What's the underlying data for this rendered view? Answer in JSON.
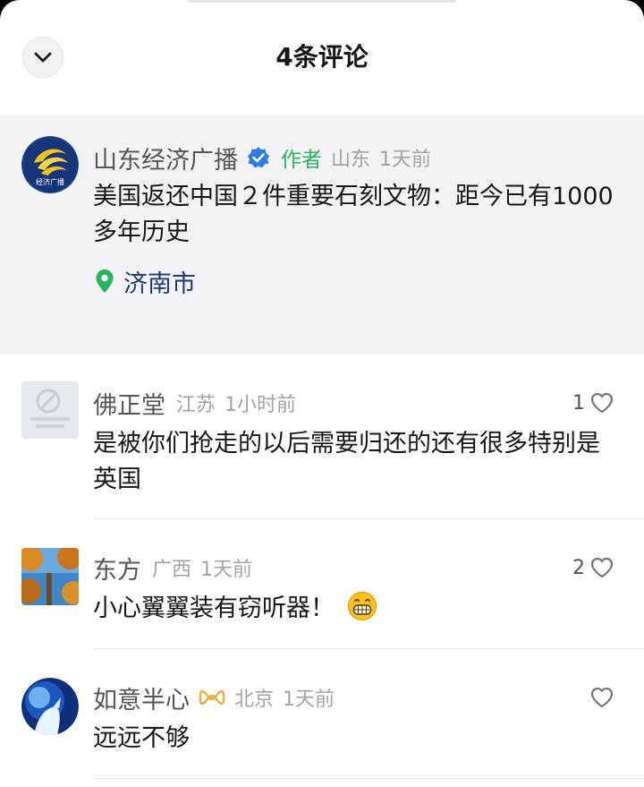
{
  "header": {
    "title": "4条评论"
  },
  "author_comment": {
    "username": "山东经济广播",
    "tag": "作者",
    "region": "山东",
    "time": "1天前",
    "text": "美国返还中国２件重要石刻文物：距今已有1000 多年历史",
    "location": "济南市",
    "avatar_text": "经济广播"
  },
  "comments": [
    {
      "username": "佛正堂",
      "region": "江苏",
      "time": "1小时前",
      "likes": "1",
      "text": "是被你们抢走的以后需要归还的还有很多特别是英国"
    },
    {
      "username": "东方",
      "region": "广西",
      "time": "1天前",
      "likes": "2",
      "text": "小心翼翼装有窃听器！"
    },
    {
      "username": "如意半心",
      "region": "北京",
      "time": "1天前",
      "likes": "",
      "text": "远远不够"
    }
  ],
  "colors": {
    "author_tag": "#27b35a",
    "location_pin": "#27b35a",
    "location_text": "#1e3a70",
    "verified_badge": "#2e7ce6"
  },
  "icons": [
    "chevron-down-icon",
    "verified-badge-icon",
    "location-pin-icon",
    "heart-outline-icon",
    "infinity-badge-icon",
    "grinning-emoji"
  ]
}
